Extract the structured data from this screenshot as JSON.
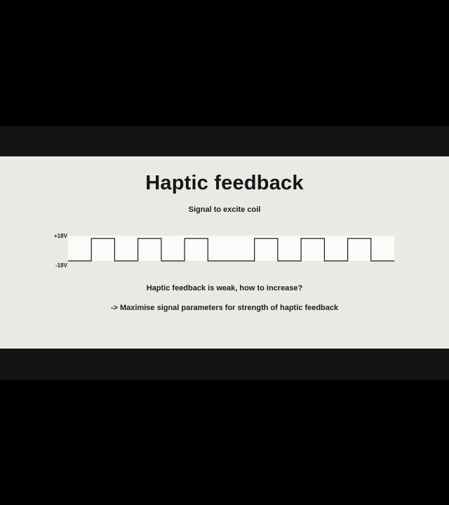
{
  "slide": {
    "title": "Haptic feedback",
    "subtitle": "Signal to excite coil",
    "question": "Haptic feedback is weak, how to increase?",
    "answer": "-> Maximise signal parameters for strength of haptic feedback"
  },
  "waveform": {
    "high_label": "+18V",
    "low_label": "-18V",
    "levels": [
      "low",
      "high",
      "low",
      "high",
      "low",
      "high",
      "low",
      "low",
      "high",
      "low",
      "high",
      "low",
      "high",
      "low"
    ]
  },
  "colors": {
    "slide_background": "#e9e9e6",
    "waveform_band": "#fbfbf9",
    "text": "#1c1c1c",
    "letterbox": "#000000"
  }
}
